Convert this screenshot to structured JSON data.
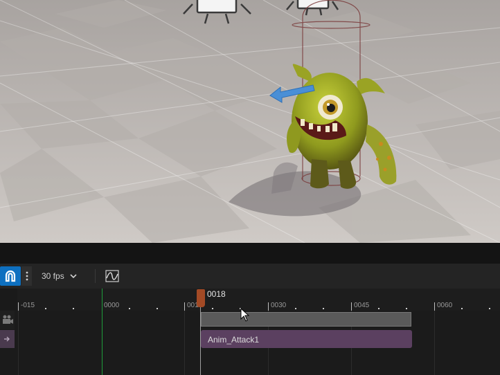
{
  "toolbar": {
    "fps_label": "30 fps"
  },
  "timeline": {
    "current_frame": "0018",
    "ticks": [
      "-015",
      "0000",
      "0015",
      "0030",
      "0045",
      "0060"
    ],
    "clip_label": "Anim_Attack1"
  },
  "icons": {
    "snap": "magnet-icon",
    "more": "more-vertical-icon",
    "dropdown": "chevron-down-icon",
    "curve": "curve-editor-icon",
    "camera": "camera-icon",
    "track": "arrow-right-icon",
    "cursor": "mouse-cursor-icon"
  },
  "colors": {
    "accent": "#0e70c0",
    "playhead": "#a34a25",
    "clip": "#5b4060",
    "start_marker": "#1f9e3c"
  }
}
